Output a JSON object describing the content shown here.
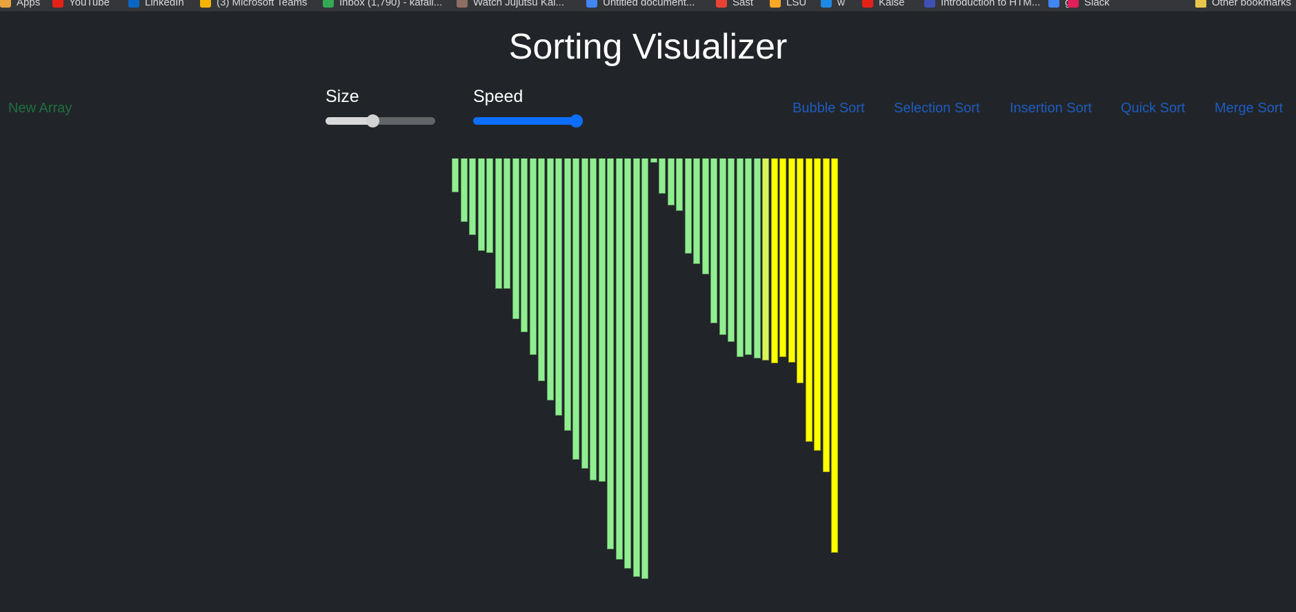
{
  "bookmarks": [
    {
      "label": "Apps",
      "icon": "apps-grid-icon",
      "color": "#e8a33d"
    },
    {
      "label": "YouTube",
      "icon": "youtube-icon",
      "color": "#e62117"
    },
    {
      "label": "LinkedIn",
      "icon": "linkedin-icon",
      "color": "#0a66c2"
    },
    {
      "label": "(3) Microsoft Teams",
      "icon": "microsoft-teams-icon",
      "color": "#f4b400"
    },
    {
      "label": "Inbox (1,790) - kafaii...",
      "icon": "gmail-icon",
      "color": "#34a853"
    },
    {
      "label": "Watch Jujutsu Kai...",
      "icon": "anime-site-icon",
      "color": "#8d6e63"
    },
    {
      "label": "Untitled document...",
      "icon": "google-docs-icon",
      "color": "#4285f4"
    },
    {
      "label": "Sast",
      "icon": "sast-icon",
      "color": "#ea4335"
    },
    {
      "label": "LSU",
      "icon": "lsu-icon",
      "color": "#f9a825"
    },
    {
      "label": "w",
      "icon": "bookmark-w-icon",
      "color": "#1e88e5"
    },
    {
      "label": "Kaise",
      "icon": "youtube-kaise-icon",
      "color": "#e62117"
    },
    {
      "label": "Introduction to HTM...",
      "icon": "course-icon",
      "color": "#3f51b5"
    },
    {
      "label": "g",
      "icon": "google-icon",
      "color": "#4285f4"
    },
    {
      "label": "Slack",
      "icon": "slack-icon",
      "color": "#e01e5a"
    },
    {
      "label": "Other bookmarks",
      "icon": "folder-icon",
      "color": "#e8c64a"
    }
  ],
  "app": {
    "title": "Sorting Visualizer",
    "new_array_label": "New Array",
    "size": {
      "label": "Size",
      "value": 0.43
    },
    "speed": {
      "label": "Speed",
      "value": 1.0
    },
    "algorithms": [
      "Bubble Sort",
      "Selection Sort",
      "Insertion Sort",
      "Quick Sort",
      "Merge Sort"
    ]
  },
  "bars": {
    "colors": {
      "sorted": "#90ee90",
      "active": "#ffff00",
      "transition": "#d8f55a"
    },
    "max_value": 613,
    "items": [
      {
        "value": 49,
        "state": "sorted"
      },
      {
        "value": 92,
        "state": "sorted"
      },
      {
        "value": 111,
        "state": "sorted"
      },
      {
        "value": 134,
        "state": "sorted"
      },
      {
        "value": 137,
        "state": "sorted"
      },
      {
        "value": 189,
        "state": "sorted"
      },
      {
        "value": 189,
        "state": "sorted"
      },
      {
        "value": 233,
        "state": "sorted"
      },
      {
        "value": 252,
        "state": "sorted"
      },
      {
        "value": 285,
        "state": "sorted"
      },
      {
        "value": 324,
        "state": "sorted"
      },
      {
        "value": 352,
        "state": "sorted"
      },
      {
        "value": 374,
        "state": "sorted"
      },
      {
        "value": 396,
        "state": "sorted"
      },
      {
        "value": 438,
        "state": "sorted"
      },
      {
        "value": 451,
        "state": "sorted"
      },
      {
        "value": 468,
        "state": "sorted"
      },
      {
        "value": 470,
        "state": "sorted"
      },
      {
        "value": 568,
        "state": "sorted"
      },
      {
        "value": 583,
        "state": "sorted"
      },
      {
        "value": 596,
        "state": "sorted"
      },
      {
        "value": 608,
        "state": "sorted"
      },
      {
        "value": 611,
        "state": "sorted"
      },
      {
        "value": 6,
        "state": "sorted"
      },
      {
        "value": 51,
        "state": "sorted"
      },
      {
        "value": 68,
        "state": "sorted"
      },
      {
        "value": 76,
        "state": "sorted"
      },
      {
        "value": 138,
        "state": "sorted"
      },
      {
        "value": 153,
        "state": "sorted"
      },
      {
        "value": 168,
        "state": "sorted"
      },
      {
        "value": 239,
        "state": "sorted"
      },
      {
        "value": 256,
        "state": "sorted"
      },
      {
        "value": 266,
        "state": "sorted"
      },
      {
        "value": 288,
        "state": "sorted"
      },
      {
        "value": 285,
        "state": "sorted"
      },
      {
        "value": 290,
        "state": "sorted"
      },
      {
        "value": 293,
        "state": "transition"
      },
      {
        "value": 297,
        "state": "active"
      },
      {
        "value": 288,
        "state": "active"
      },
      {
        "value": 296,
        "state": "active"
      },
      {
        "value": 327,
        "state": "active"
      },
      {
        "value": 412,
        "state": "active"
      },
      {
        "value": 425,
        "state": "active"
      },
      {
        "value": 456,
        "state": "active"
      },
      {
        "value": 573,
        "state": "active"
      }
    ]
  }
}
